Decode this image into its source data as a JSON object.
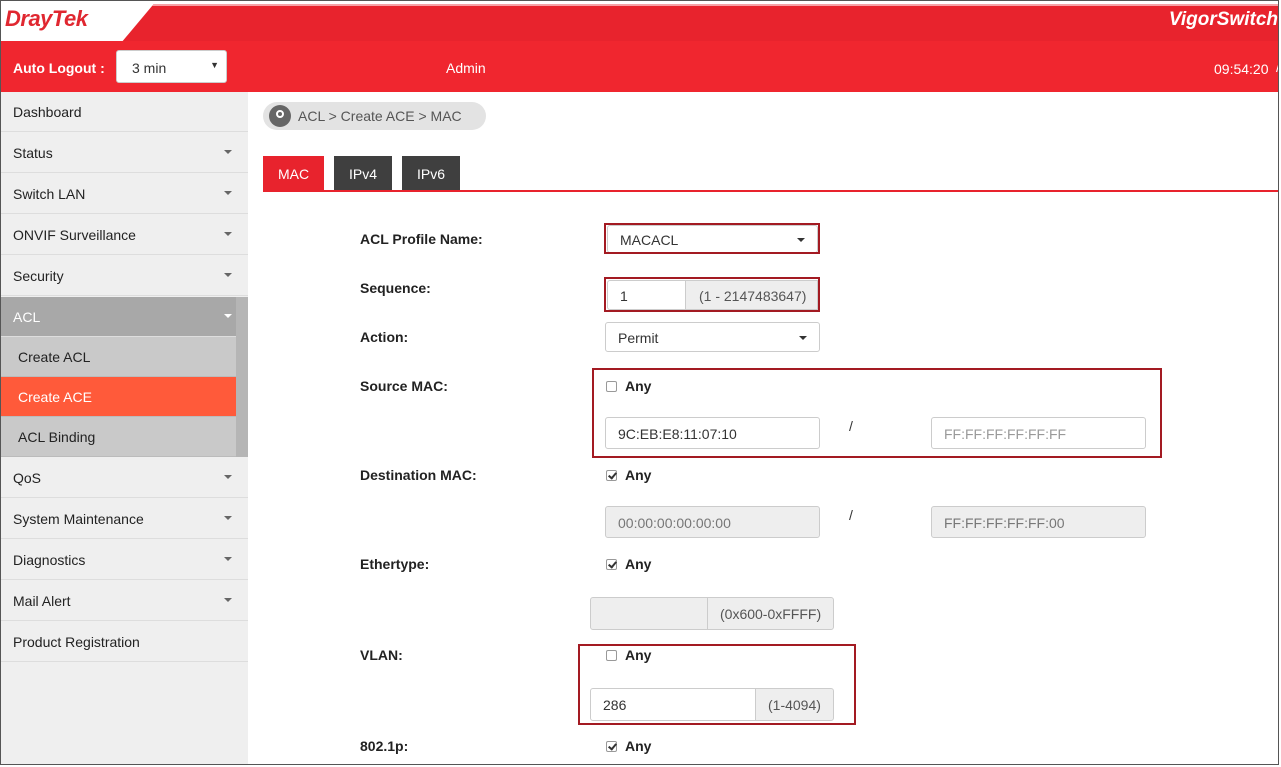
{
  "header": {
    "logo": {
      "dray": "Dray",
      "tek": "Tek"
    },
    "product": "VigorSwitch",
    "auto_logout_label": "Auto Logout :",
    "auto_logout_value": "3 min",
    "user": "Admin",
    "time": "09:54:20",
    "brand_color": "#e8232d"
  },
  "sidebar": {
    "items": [
      {
        "label": "Dashboard",
        "caret": false
      },
      {
        "label": "Status",
        "caret": true
      },
      {
        "label": "Switch LAN",
        "caret": true
      },
      {
        "label": "ONVIF Surveillance",
        "caret": true
      },
      {
        "label": "Security",
        "caret": true
      },
      {
        "label": "ACL",
        "caret": true,
        "expanded": true
      },
      {
        "label": "Create ACL",
        "sub": true
      },
      {
        "label": "Create ACE",
        "sub": true,
        "active": true
      },
      {
        "label": "ACL Binding",
        "sub": true
      },
      {
        "label": "QoS",
        "caret": true
      },
      {
        "label": "System Maintenance",
        "caret": true
      },
      {
        "label": "Diagnostics",
        "caret": true
      },
      {
        "label": "Mail Alert",
        "caret": true
      },
      {
        "label": "Product Registration",
        "caret": false
      }
    ]
  },
  "breadcrumb": "ACL > Create ACE  > MAC",
  "tabs": [
    {
      "label": "MAC",
      "active": true
    },
    {
      "label": "IPv4",
      "active": false
    },
    {
      "label": "IPv6",
      "active": false
    }
  ],
  "form": {
    "acl_profile_name": {
      "label": "ACL Profile Name:",
      "value": "MACACL"
    },
    "sequence": {
      "label": "Sequence:",
      "value": "1",
      "range": "(1 - 2147483647)"
    },
    "action": {
      "label": "Action:",
      "value": "Permit"
    },
    "source_mac": {
      "label": "Source MAC:",
      "any_label": "Any",
      "any_checked": false,
      "value": "9C:EB:E8:11:07:10",
      "mask_placeholder": "FF:FF:FF:FF:FF:FF",
      "separator": "/"
    },
    "destination_mac": {
      "label": "Destination MAC:",
      "any_label": "Any",
      "any_checked": true,
      "value": "00:00:00:00:00:00",
      "mask": "FF:FF:FF:FF:FF:00",
      "separator": "/"
    },
    "ethertype": {
      "label": "Ethertype:",
      "any_label": "Any",
      "any_checked": true,
      "value": "",
      "range": "(0x600-0xFFFF)"
    },
    "vlan": {
      "label": "VLAN:",
      "any_label": "Any",
      "any_checked": false,
      "value": "286",
      "range": "(1-4094)"
    },
    "dot1p": {
      "label": "802.1p:",
      "any_label": "Any",
      "any_checked": true
    }
  }
}
